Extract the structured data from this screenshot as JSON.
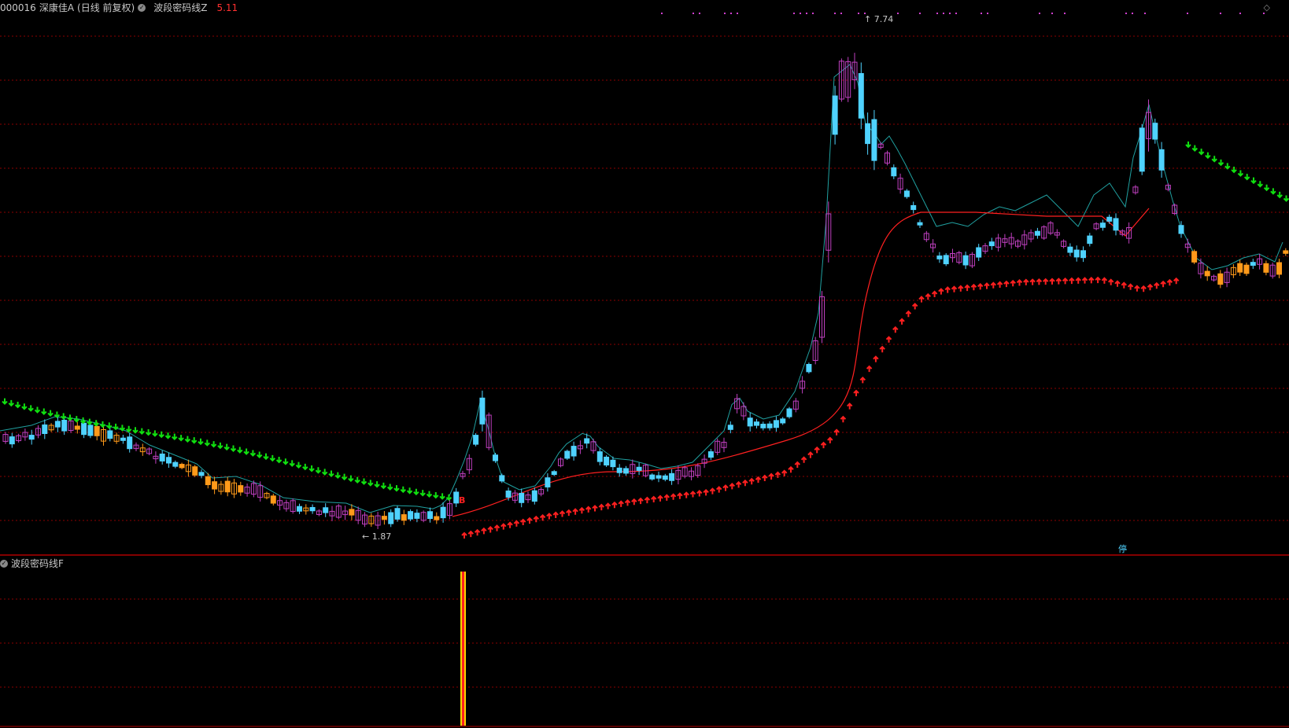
{
  "header": {
    "code": "000016",
    "name": "深康佳A",
    "period": "(日线 前复权)",
    "indicator_main": "波段密码线Z",
    "indicator_value": "5.11"
  },
  "sub_panel": {
    "indicator_name": "波段密码线F"
  },
  "annotations": {
    "high_label": "7.74",
    "low_label": "1.87",
    "buy_marker": "B",
    "stop_marker": "停"
  },
  "colors": {
    "background": "#000000",
    "grid": "#8b0000",
    "up_candle": "#c040c0",
    "down_candle": "#4fd2ff",
    "red_line": "#ff2020",
    "teal_line": "#20a0a0",
    "sell_arrow": "#10e010",
    "buy_arrow": "#ff2020",
    "orange_candle": "#ff9a1a"
  },
  "icons": {
    "settings_dot": "gear-dot-icon",
    "corner": "diamond-icon"
  },
  "chart_data": {
    "type": "candlestick",
    "title": "000016 深康佳A (日线 前复权)",
    "ylim": [
      1.6,
      8.1
    ],
    "high": 7.74,
    "low": 1.87,
    "indicator_value": 5.11
  }
}
